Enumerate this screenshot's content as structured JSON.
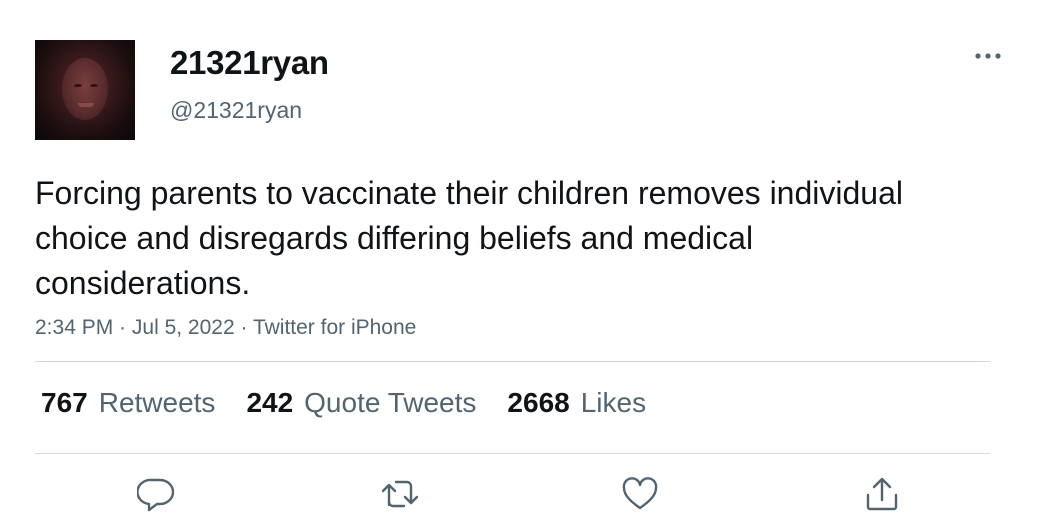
{
  "user": {
    "display_name": "21321ryan",
    "handle": "@21321ryan"
  },
  "tweet": {
    "text": "Forcing parents to vaccinate their children removes individual choice and disregards differing beliefs and medical considerations.",
    "time": "2:34 PM",
    "date": "Jul 5, 2022",
    "source": "Twitter for iPhone",
    "separator": " · "
  },
  "stats": {
    "retweets": {
      "count": "767",
      "label": "Retweets"
    },
    "quote_tweets": {
      "count": "242",
      "label": "Quote Tweets"
    },
    "likes": {
      "count": "2668",
      "label": "Likes"
    }
  },
  "icons": {
    "more": "more-horizontal-icon",
    "reply": "reply-icon",
    "retweet": "retweet-icon",
    "like": "heart-icon",
    "share": "share-icon"
  },
  "colors": {
    "text_primary": "#0f1419",
    "text_secondary": "#536471",
    "divider": "#cfd9de",
    "icon": "#536471"
  }
}
